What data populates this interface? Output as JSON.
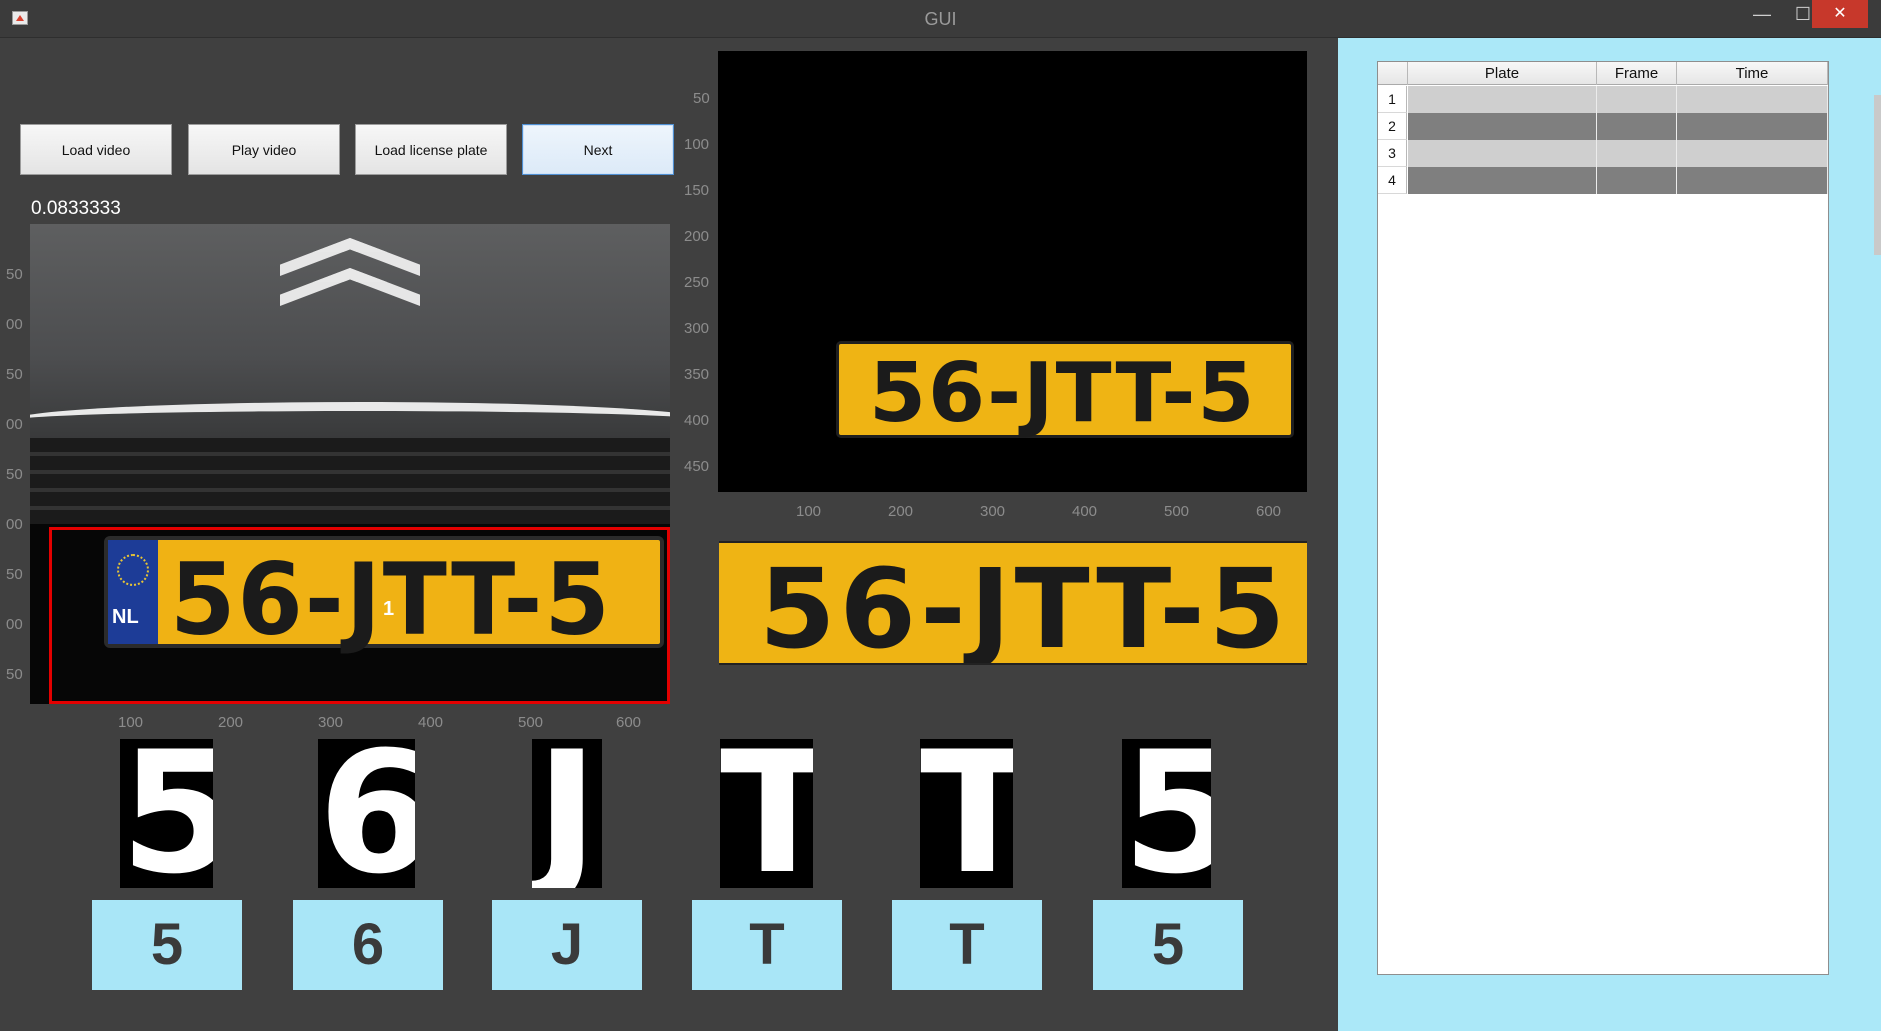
{
  "window": {
    "title": "GUI"
  },
  "controls": {
    "minimize": "—",
    "maximize": "☐",
    "close": "✕"
  },
  "toolbar": {
    "load_video": "Load video",
    "play_video": "Play video",
    "load_license_plate": "Load license plate",
    "next": "Next"
  },
  "ratio_value": "0.0833333",
  "detection_label": "1",
  "left_axes": {
    "x_ticks": [
      "100",
      "200",
      "300",
      "400",
      "500",
      "600"
    ],
    "y_ticks": [
      "50",
      "00",
      "50",
      "00",
      "50",
      "00",
      "50",
      "00",
      "50"
    ],
    "plate_text": "56-JTT-5",
    "plate_country": "NL"
  },
  "right_axes": {
    "x_ticks": [
      "100",
      "200",
      "300",
      "400",
      "500",
      "600"
    ],
    "y_ticks": [
      "50",
      "100",
      "150",
      "200",
      "250",
      "300",
      "350",
      "400",
      "450"
    ],
    "plate_text": "56-JTT-5"
  },
  "cropped_plate_text": "56-JTT-5",
  "segmented_chars": [
    "5",
    "6",
    "J",
    "T",
    "T",
    "5"
  ],
  "recognized_chars": [
    "5",
    "6",
    "J",
    "T",
    "T",
    "5"
  ],
  "results_table": {
    "columns": [
      "Plate",
      "Frame",
      "Time"
    ],
    "rows": [
      {
        "num": "1",
        "plate": "",
        "frame": "",
        "time": ""
      },
      {
        "num": "2",
        "plate": "",
        "frame": "",
        "time": ""
      },
      {
        "num": "3",
        "plate": "",
        "frame": "",
        "time": ""
      },
      {
        "num": "4",
        "plate": "",
        "frame": "",
        "time": ""
      }
    ]
  },
  "colors": {
    "background": "#404040",
    "panel": "#abe8f8",
    "plate_yellow": "#efb414",
    "bbox_red": "#e30000",
    "row_light": "#cfcfcf",
    "row_dark": "#7f7f7f"
  }
}
